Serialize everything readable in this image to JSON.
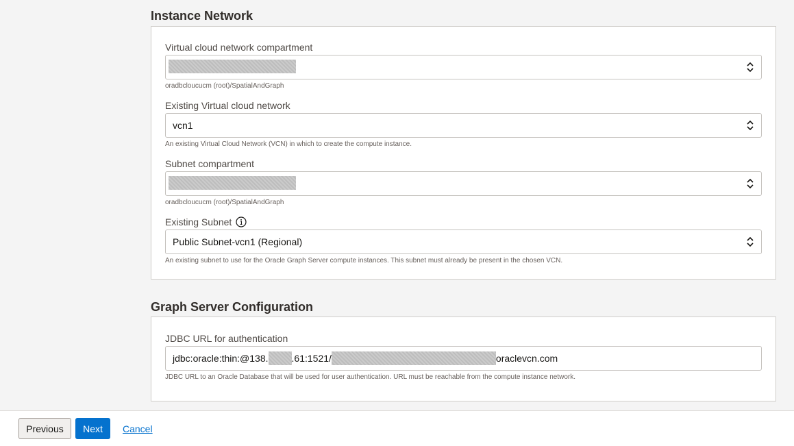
{
  "sections": {
    "network": {
      "title": "Instance Network",
      "vcn_compartment": {
        "label": "Virtual cloud network compartment",
        "help": "oradbcloucucm (root)/SpatialAndGraph"
      },
      "vcn": {
        "label": "Existing Virtual cloud network",
        "value": "vcn1",
        "help": "An existing Virtual Cloud Network (VCN) in which to create the compute instance."
      },
      "subnet_compartment": {
        "label": "Subnet compartment",
        "help": "oradbcloucucm (root)/SpatialAndGraph"
      },
      "subnet": {
        "label": "Existing Subnet",
        "value": "Public Subnet-vcn1 (Regional)",
        "help": "An existing subnet to use for the Oracle Graph Server compute instances. This subnet must already be present in the chosen VCN."
      }
    },
    "graph": {
      "title": "Graph Server Configuration",
      "jdbc": {
        "label": "JDBC URL for authentication",
        "value_part1": "jdbc:oracle:thin:@138.",
        "value_part2": ".61:1521/",
        "value_part3": "oraclevcn.com",
        "help": "JDBC URL to an Oracle Database that will be used for user authentication. URL must be reachable from the compute instance network."
      }
    }
  },
  "footer": {
    "previous": "Previous",
    "next": "Next",
    "cancel": "Cancel"
  },
  "icons": {
    "select": "chevron-up-down-icon",
    "info": "info-icon"
  },
  "colors": {
    "accent": "#0572ce"
  }
}
